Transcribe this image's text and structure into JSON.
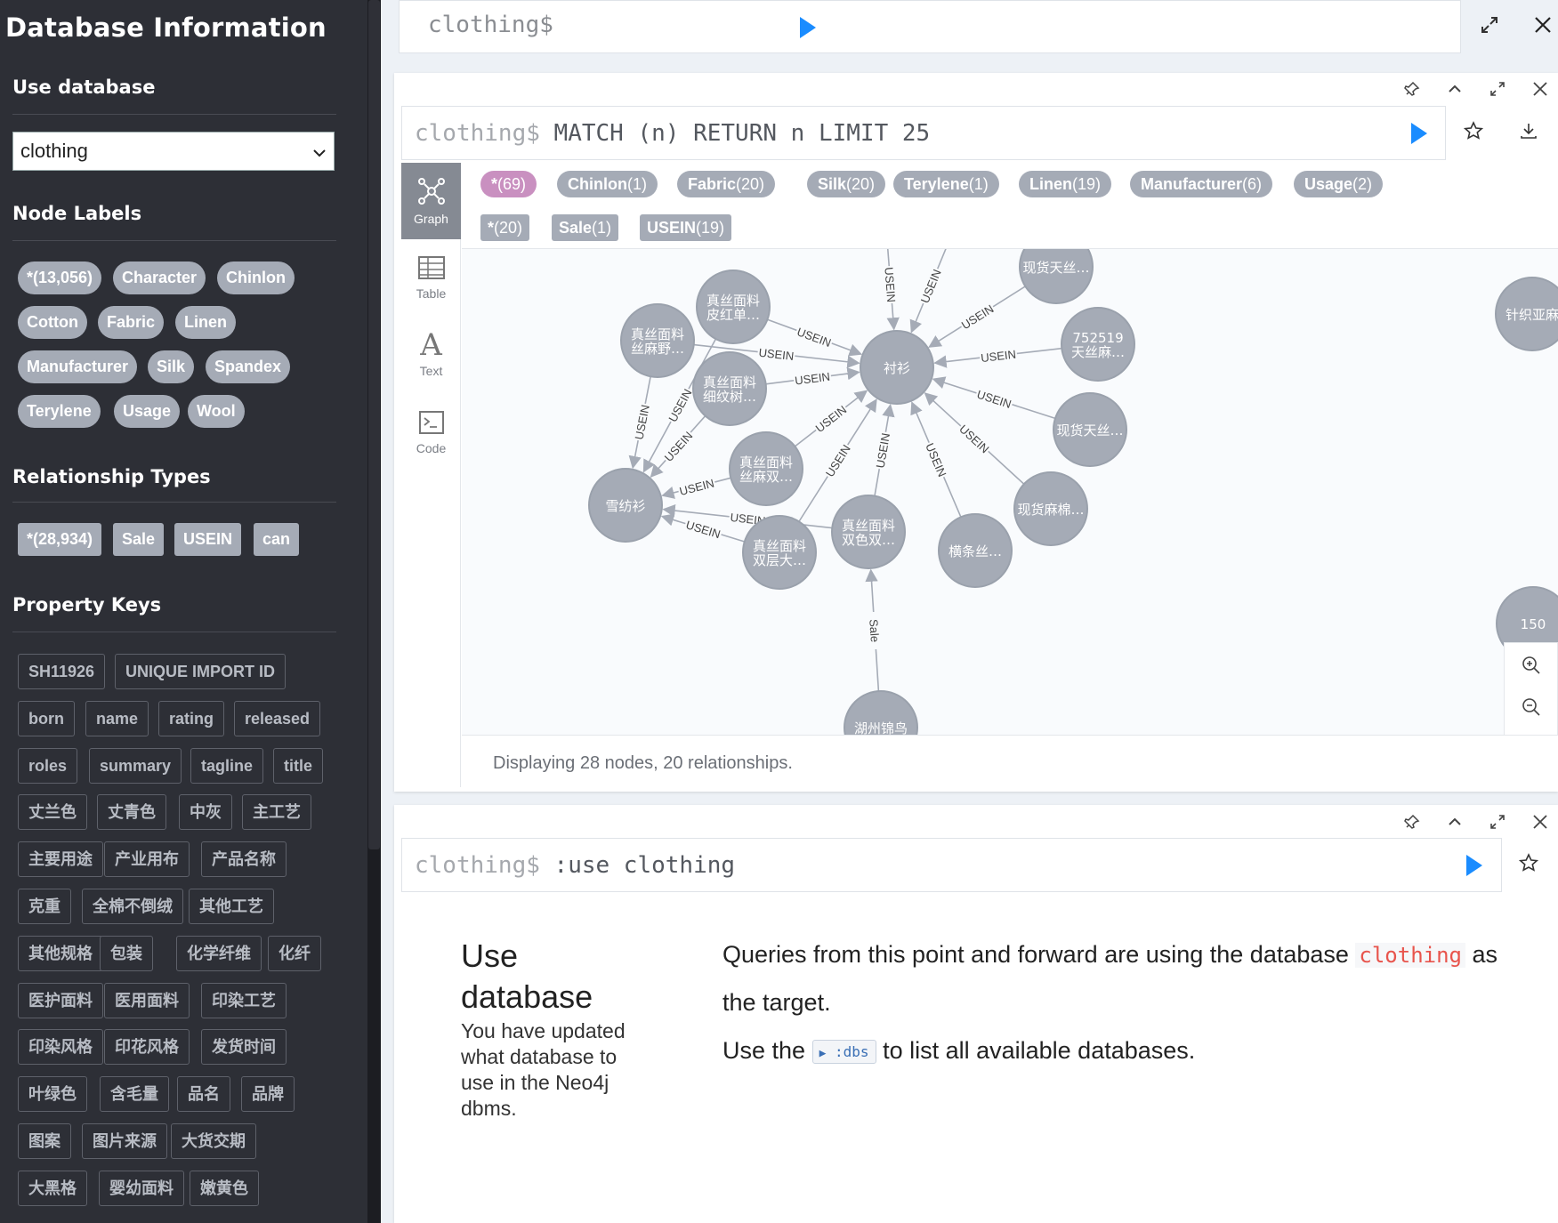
{
  "sidebar": {
    "title": "Database Information",
    "use_database_heading": "Use database",
    "selected_database": "clothing",
    "node_labels_heading": "Node Labels",
    "node_labels": [
      "*(13,056)",
      "Character",
      "Chinlon",
      "Cotton",
      "Fabric",
      "Linen",
      "Manufacturer",
      "Silk",
      "Spandex",
      "Terylene",
      "Usage",
      "Wool"
    ],
    "relationship_types_heading": "Relationship Types",
    "relationship_types": [
      "*(28,934)",
      "Sale",
      "USEIN",
      "can"
    ],
    "property_keys_heading": "Property Keys",
    "property_keys": [
      "SH11926",
      "UNIQUE IMPORT ID",
      "born",
      "name",
      "rating",
      "released",
      "roles",
      "summary",
      "tagline",
      "title",
      "丈兰色",
      "丈青色",
      "中灰",
      "主工艺",
      "主要用途",
      "产业用布",
      "产品名称",
      "克重",
      "全棉不倒绒",
      "其他工艺",
      "其他规格",
      "包装",
      "化学纤维",
      "化纤",
      "医护面料",
      "医用面料",
      "印染工艺",
      "印染风格",
      "印花风格",
      "发货时间",
      "叶绿色",
      "含毛量",
      "品名",
      "品牌",
      "图案",
      "图片来源",
      "大货交期",
      "大黑格",
      "婴幼面料",
      "嫩黄色"
    ]
  },
  "frame_top": {
    "prompt": "clothing$",
    "query": ""
  },
  "frame_graph": {
    "prompt": "clothing$",
    "query": " MATCH (n) RETURN n LIMIT 25",
    "nav": {
      "graph": "Graph",
      "table": "Table",
      "text": "Text",
      "code": "Code"
    },
    "node_pills": [
      {
        "name": "*",
        "count": "(69)"
      },
      {
        "name": "Chinlon",
        "count": "(1)"
      },
      {
        "name": "Fabric",
        "count": "(20)"
      },
      {
        "name": "Silk",
        "count": "(20)"
      },
      {
        "name": "Terylene",
        "count": "(1)"
      },
      {
        "name": "Linen",
        "count": "(19)"
      },
      {
        "name": "Manufacturer",
        "count": "(6)"
      },
      {
        "name": "Usage",
        "count": "(2)"
      }
    ],
    "rel_pills": [
      {
        "name": "*",
        "count": "(20)"
      },
      {
        "name": "Sale",
        "count": "(1)"
      },
      {
        "name": "USEIN",
        "count": "(19)"
      }
    ],
    "status": "Displaying 28 nodes, 20 relationships.",
    "graph": {
      "nodes": [
        {
          "id": "center",
          "label": [
            "衬衫"
          ]
        },
        {
          "id": "xfs",
          "label": [
            "雪纺衫"
          ]
        },
        {
          "id": "n1",
          "label": [
            "真丝面料",
            "皮红单…"
          ]
        },
        {
          "id": "n2",
          "label": [
            "真丝面料",
            "丝麻野…"
          ]
        },
        {
          "id": "n3",
          "label": [
            "真丝面料",
            "细纹树…"
          ]
        },
        {
          "id": "n4",
          "label": [
            "真丝面料",
            "丝麻双…"
          ]
        },
        {
          "id": "n5",
          "label": [
            "真丝面料",
            "双层大…"
          ]
        },
        {
          "id": "n6",
          "label": [
            "真丝面料",
            "双色双…"
          ]
        },
        {
          "id": "n7",
          "label": [
            "横条丝…"
          ]
        },
        {
          "id": "n8",
          "label": [
            "现货麻棉…"
          ]
        },
        {
          "id": "n9",
          "label": [
            "现货天丝…"
          ]
        },
        {
          "id": "n10",
          "label": [
            "752519",
            "天丝麻…"
          ]
        },
        {
          "id": "n11",
          "label": [
            "现货天丝…"
          ]
        },
        {
          "id": "n12",
          "label": [
            "湖州锦鸟"
          ]
        },
        {
          "id": "n13",
          "label": [
            "针织亚麻"
          ]
        },
        {
          "id": "n14",
          "label": [
            "150"
          ]
        }
      ],
      "edge_label_usein": "USEIN",
      "edge_label_sale": "Sale"
    }
  },
  "frame_use": {
    "prompt": "clothing$",
    "query": " :use clothing",
    "title": "Use database",
    "description": "You have updated what database to use in the Neo4j dbms.",
    "line1_a": "Queries from this point and forward are using the database ",
    "line1_code": "clothing",
    "line1_b": " as",
    "line2": "the target.",
    "line3_a": "Use the ",
    "line3_btn": ":dbs",
    "line3_b": " to list all available databases."
  },
  "colors": {
    "accent": "#1a8cff",
    "node": "#a5abb6",
    "pill_all": "#c990c0",
    "sidebar_bg": "#2d2f36"
  }
}
